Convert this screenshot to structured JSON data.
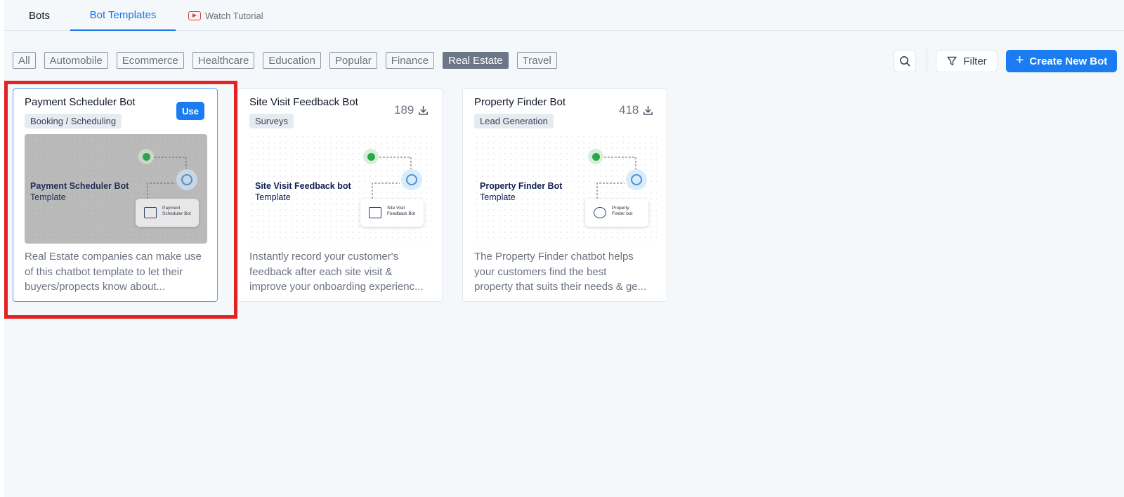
{
  "tabs": {
    "bots": "Bots",
    "bot_templates": "Bot Templates",
    "watch_tutorial": "Watch Tutorial"
  },
  "categories": [
    "All",
    "Automobile",
    "Ecommerce",
    "Healthcare",
    "Education",
    "Popular",
    "Finance",
    "Real Estate",
    "Travel"
  ],
  "active_category": "Real Estate",
  "toolbar": {
    "search_icon": "search-icon",
    "filter_label": "Filter",
    "create_label": "Create New Bot"
  },
  "cards": [
    {
      "title": "Payment Scheduler Bot",
      "tag": "Booking / Scheduling",
      "action": "Use",
      "thumb_title_bold": "Payment Scheduler Bot",
      "thumb_title_rest": "Template",
      "node_label_1": "Payment",
      "node_label_2": "Scheduler Bot",
      "desc_lines": [
        "Real Estate companies can make use",
        "of this chatbot template to let their",
        "buyers/propects know about..."
      ]
    },
    {
      "title": "Site Visit Feedback Bot",
      "tag": "Surveys",
      "count": "189",
      "thumb_title_bold": "Site Visit Feedback bot",
      "thumb_title_rest": "Template",
      "node_label_1": "Site Visit",
      "node_label_2": "Feedback Bot",
      "desc_lines": [
        "Instantly record your customer's",
        "feedback after each site visit &",
        "improve your onboarding experienc..."
      ]
    },
    {
      "title": "Property Finder Bot",
      "tag": "Lead Generation",
      "count": "418",
      "thumb_title_bold": "Property Finder Bot",
      "thumb_title_rest": "Template",
      "node_label_1": "Property",
      "node_label_2": "Finder bot",
      "desc_lines": [
        "The Property Finder chatbot helps",
        "your customers find the best",
        "property that suits their needs & ge..."
      ]
    }
  ],
  "colors": {
    "accent": "#1a7cf0",
    "highlight": "#e32222",
    "active_chip": "#6b7687"
  }
}
